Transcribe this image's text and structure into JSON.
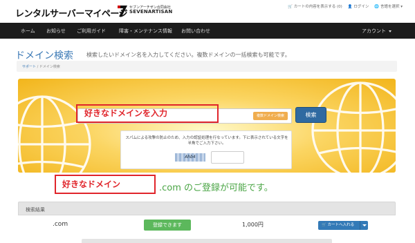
{
  "header": {
    "logo_text": "レンタルサーバーマイページ",
    "company_jp": "セブンアーチザン合同会社",
    "company_en": "SEVENARTISAN",
    "links": [
      "🛒 カートの内容を表示する (0)",
      "👤 ログイン",
      "🌐 言語を選択 ▾"
    ]
  },
  "nav": {
    "items": [
      "ホーム",
      "お知らせ",
      "ご利用ガイド",
      "障害・メンテナンス情報",
      "お問い合わせ"
    ],
    "account": "アカウント"
  },
  "page": {
    "title": "ドメイン検索",
    "description": "検索したいドメイン名を入力してください。複数ドメインの一括検索も可能です。",
    "breadcrumb": [
      "サポート",
      "ドメイン検索"
    ]
  },
  "search": {
    "annotation_input": "好きなドメインを入力",
    "multi_button": "複数ドメイン検索",
    "search_button": "検索",
    "captcha_text": "スパムによる攻撃の防止のため、入力の認証処理を行なっています。下に表示されている文字を半角でご入力下さい。",
    "captcha_code": "Ahb4"
  },
  "result": {
    "annotation_domain": "好きなドメイン",
    "available_text": ".com のご登録が可能です。",
    "panel_title": "検索結果",
    "rows": [
      {
        "tld": ".com",
        "status": "登録できます",
        "price": "1,000円",
        "cart": "カートへ入れる"
      }
    ]
  },
  "colors": {
    "accent": "#3a78b5",
    "nav_bg": "#1c1c1c",
    "highlight": "#e0242a",
    "available": "#4aa545"
  }
}
